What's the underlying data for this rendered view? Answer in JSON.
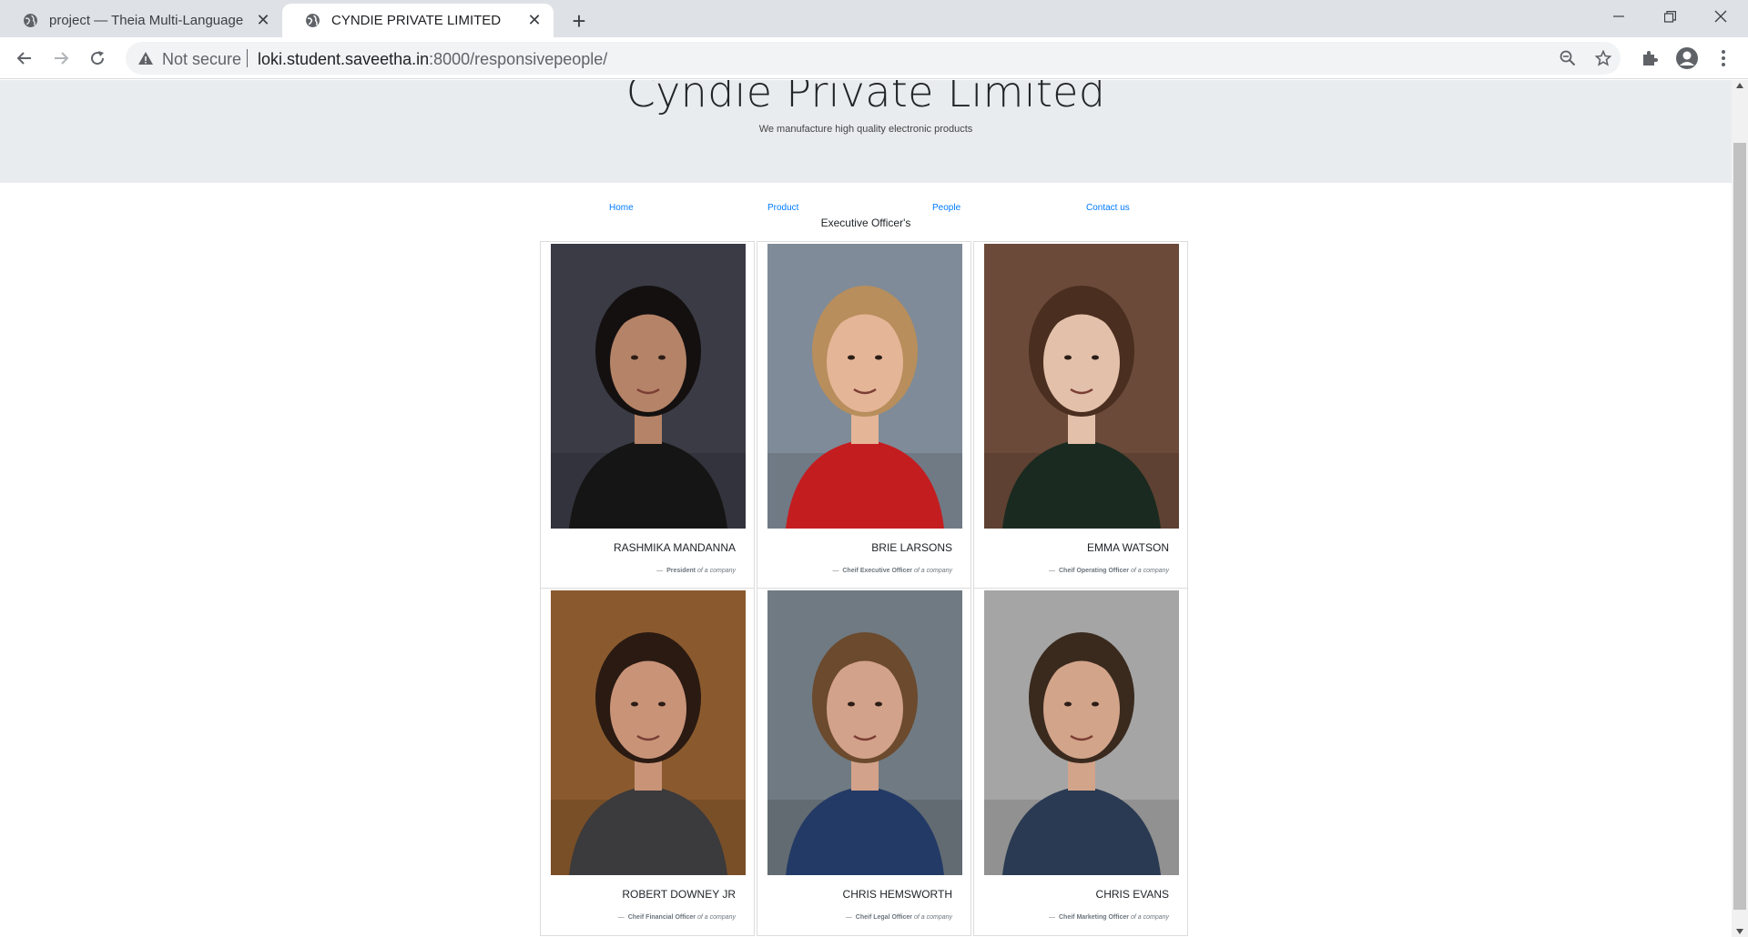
{
  "browser": {
    "tabs": [
      {
        "title": "project — Theia Multi-Language",
        "active": false
      },
      {
        "title": "CYNDIE PRIVATE LIMITED",
        "active": true
      }
    ],
    "address": {
      "security": "Not secure",
      "host": "loki.student.saveetha.in",
      "path": ":8000/responsivepeople/"
    }
  },
  "site": {
    "brand": "Cyndie Private Limited",
    "tagline": "We manufacture high quality electronic products",
    "nav": [
      "Home",
      "Product",
      "People",
      "Contact us"
    ],
    "section_title": "Executive Officer's"
  },
  "people": [
    {
      "name": "RASHMIKA MANDANNA",
      "role": "President",
      "suffix": "of a company",
      "bg": "#3b3b46",
      "skin": "#b58367",
      "hair": "#141010",
      "clothes": "#151515"
    },
    {
      "name": "BRIE LARSONS",
      "role": "Cheif Executive Officer",
      "suffix": "of a company",
      "bg": "#7f8b98",
      "skin": "#e5b597",
      "hair": "#b88e5c",
      "clothes": "#c41d20"
    },
    {
      "name": "EMMA WATSON",
      "role": "Cheif Operating Officer",
      "suffix": "of a company",
      "bg": "#6b4a3a",
      "skin": "#e3c0aa",
      "hair": "#4a2e1f",
      "clothes": "#1a2a20"
    },
    {
      "name": "ROBERT DOWNEY JR",
      "role": "Cheif Financial Officer",
      "suffix": "of a company",
      "bg": "#8a5a2e",
      "skin": "#c99378",
      "hair": "#2a1a12",
      "clothes": "#3b3a3c"
    },
    {
      "name": "CHRIS HEMSWORTH",
      "role": "Cheif Legal Officer",
      "suffix": "of a company",
      "bg": "#707a82",
      "skin": "#d3a28a",
      "hair": "#6b4a2e",
      "clothes": "#233a66"
    },
    {
      "name": "CHRIS EVANS",
      "role": "Cheif Marketing Officer",
      "suffix": "of a company",
      "bg": "#a5a5a5",
      "skin": "#d2a48a",
      "hair": "#3a2a1e",
      "clothes": "#2a3a52"
    }
  ]
}
